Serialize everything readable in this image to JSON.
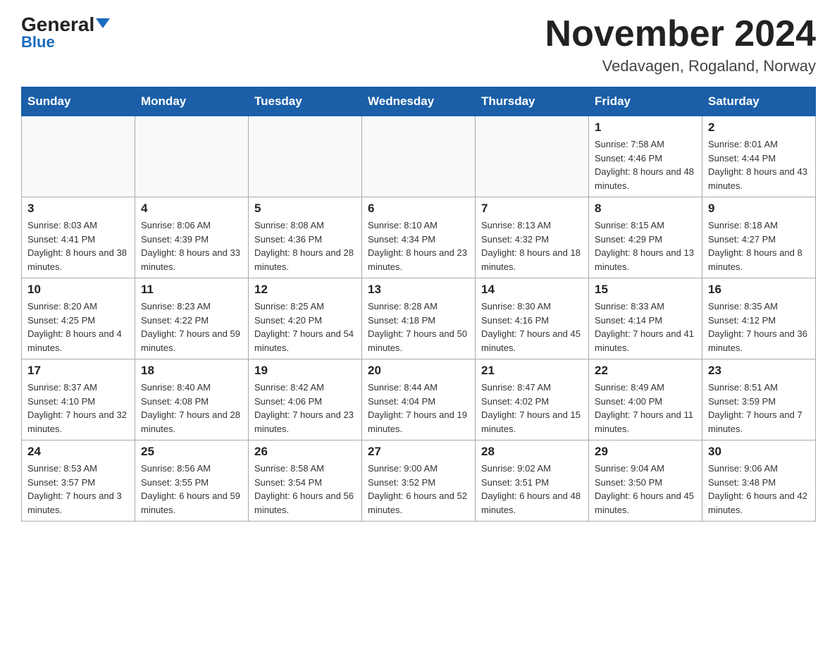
{
  "header": {
    "logo_general": "General",
    "logo_blue": "Blue",
    "month_title": "November 2024",
    "location": "Vedavagen, Rogaland, Norway"
  },
  "weekdays": [
    "Sunday",
    "Monday",
    "Tuesday",
    "Wednesday",
    "Thursday",
    "Friday",
    "Saturday"
  ],
  "weeks": [
    [
      {
        "day": "",
        "info": ""
      },
      {
        "day": "",
        "info": ""
      },
      {
        "day": "",
        "info": ""
      },
      {
        "day": "",
        "info": ""
      },
      {
        "day": "",
        "info": ""
      },
      {
        "day": "1",
        "info": "Sunrise: 7:58 AM\nSunset: 4:46 PM\nDaylight: 8 hours and 48 minutes."
      },
      {
        "day": "2",
        "info": "Sunrise: 8:01 AM\nSunset: 4:44 PM\nDaylight: 8 hours and 43 minutes."
      }
    ],
    [
      {
        "day": "3",
        "info": "Sunrise: 8:03 AM\nSunset: 4:41 PM\nDaylight: 8 hours and 38 minutes."
      },
      {
        "day": "4",
        "info": "Sunrise: 8:06 AM\nSunset: 4:39 PM\nDaylight: 8 hours and 33 minutes."
      },
      {
        "day": "5",
        "info": "Sunrise: 8:08 AM\nSunset: 4:36 PM\nDaylight: 8 hours and 28 minutes."
      },
      {
        "day": "6",
        "info": "Sunrise: 8:10 AM\nSunset: 4:34 PM\nDaylight: 8 hours and 23 minutes."
      },
      {
        "day": "7",
        "info": "Sunrise: 8:13 AM\nSunset: 4:32 PM\nDaylight: 8 hours and 18 minutes."
      },
      {
        "day": "8",
        "info": "Sunrise: 8:15 AM\nSunset: 4:29 PM\nDaylight: 8 hours and 13 minutes."
      },
      {
        "day": "9",
        "info": "Sunrise: 8:18 AM\nSunset: 4:27 PM\nDaylight: 8 hours and 8 minutes."
      }
    ],
    [
      {
        "day": "10",
        "info": "Sunrise: 8:20 AM\nSunset: 4:25 PM\nDaylight: 8 hours and 4 minutes."
      },
      {
        "day": "11",
        "info": "Sunrise: 8:23 AM\nSunset: 4:22 PM\nDaylight: 7 hours and 59 minutes."
      },
      {
        "day": "12",
        "info": "Sunrise: 8:25 AM\nSunset: 4:20 PM\nDaylight: 7 hours and 54 minutes."
      },
      {
        "day": "13",
        "info": "Sunrise: 8:28 AM\nSunset: 4:18 PM\nDaylight: 7 hours and 50 minutes."
      },
      {
        "day": "14",
        "info": "Sunrise: 8:30 AM\nSunset: 4:16 PM\nDaylight: 7 hours and 45 minutes."
      },
      {
        "day": "15",
        "info": "Sunrise: 8:33 AM\nSunset: 4:14 PM\nDaylight: 7 hours and 41 minutes."
      },
      {
        "day": "16",
        "info": "Sunrise: 8:35 AM\nSunset: 4:12 PM\nDaylight: 7 hours and 36 minutes."
      }
    ],
    [
      {
        "day": "17",
        "info": "Sunrise: 8:37 AM\nSunset: 4:10 PM\nDaylight: 7 hours and 32 minutes."
      },
      {
        "day": "18",
        "info": "Sunrise: 8:40 AM\nSunset: 4:08 PM\nDaylight: 7 hours and 28 minutes."
      },
      {
        "day": "19",
        "info": "Sunrise: 8:42 AM\nSunset: 4:06 PM\nDaylight: 7 hours and 23 minutes."
      },
      {
        "day": "20",
        "info": "Sunrise: 8:44 AM\nSunset: 4:04 PM\nDaylight: 7 hours and 19 minutes."
      },
      {
        "day": "21",
        "info": "Sunrise: 8:47 AM\nSunset: 4:02 PM\nDaylight: 7 hours and 15 minutes."
      },
      {
        "day": "22",
        "info": "Sunrise: 8:49 AM\nSunset: 4:00 PM\nDaylight: 7 hours and 11 minutes."
      },
      {
        "day": "23",
        "info": "Sunrise: 8:51 AM\nSunset: 3:59 PM\nDaylight: 7 hours and 7 minutes."
      }
    ],
    [
      {
        "day": "24",
        "info": "Sunrise: 8:53 AM\nSunset: 3:57 PM\nDaylight: 7 hours and 3 minutes."
      },
      {
        "day": "25",
        "info": "Sunrise: 8:56 AM\nSunset: 3:55 PM\nDaylight: 6 hours and 59 minutes."
      },
      {
        "day": "26",
        "info": "Sunrise: 8:58 AM\nSunset: 3:54 PM\nDaylight: 6 hours and 56 minutes."
      },
      {
        "day": "27",
        "info": "Sunrise: 9:00 AM\nSunset: 3:52 PM\nDaylight: 6 hours and 52 minutes."
      },
      {
        "day": "28",
        "info": "Sunrise: 9:02 AM\nSunset: 3:51 PM\nDaylight: 6 hours and 48 minutes."
      },
      {
        "day": "29",
        "info": "Sunrise: 9:04 AM\nSunset: 3:50 PM\nDaylight: 6 hours and 45 minutes."
      },
      {
        "day": "30",
        "info": "Sunrise: 9:06 AM\nSunset: 3:48 PM\nDaylight: 6 hours and 42 minutes."
      }
    ]
  ]
}
